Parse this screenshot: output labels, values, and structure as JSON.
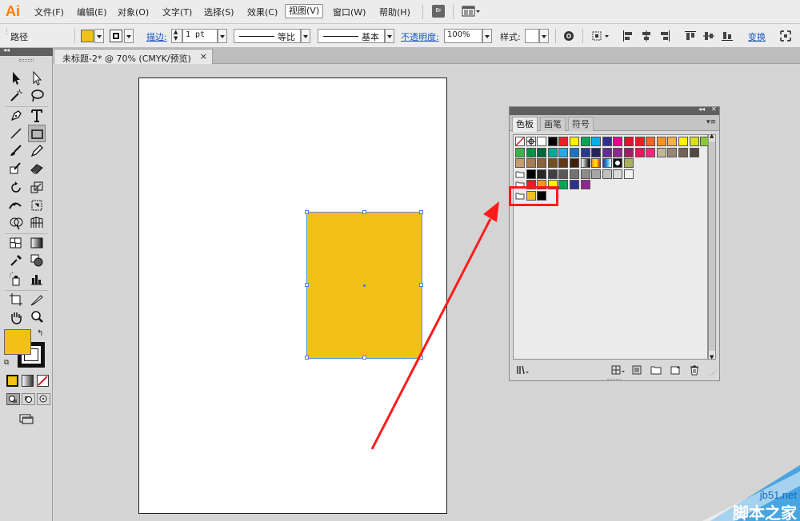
{
  "app": {
    "logo": "Ai"
  },
  "menu": {
    "file": "文件(F)",
    "edit": "编辑(E)",
    "object": "对象(O)",
    "type": "文字(T)",
    "select": "选择(S)",
    "effect": "效果(C)",
    "view": "视图(V)",
    "window": "窗口(W)",
    "help": "帮助(H)",
    "bridge": "Br"
  },
  "control": {
    "selection_type": "路径",
    "stroke_label": "描边:",
    "stroke_weight": "1 pt",
    "profile": "等比",
    "brush": "基本",
    "opacity_label": "不透明度:",
    "opacity": "100%",
    "style_label": "样式:",
    "transform": "变换"
  },
  "document": {
    "tab_title": "未标题-2* @ 70% (CMYK/预览)",
    "close": "×"
  },
  "swatches_panel": {
    "tabs": [
      "色板",
      "画笔",
      "符号"
    ],
    "rows": [
      [
        "none",
        "registration",
        "#ffffff",
        "#000000",
        "#ee1c25",
        "#fff200",
        "#00a651",
        "#00aeef",
        "#2e3192",
        "#ec008c",
        "#d7182a",
        "#ed1c24",
        "#f26522",
        "#f7941d",
        "#fbb040",
        "#fff200",
        "#d7df23",
        "#8dc63f"
      ],
      [
        "#39b54a",
        "#009444",
        "#006838",
        "#00a79d",
        "#27aae1",
        "#1c75bc",
        "#2b388f",
        "#262262",
        "#662d91",
        "#92278f",
        "#9e1f63",
        "#da1c5c",
        "#ee2a7b",
        "#c2b59b",
        "#998675",
        "#736357",
        "#534741"
      ],
      [
        "#c69c6d",
        "#a67c52",
        "#8c6239",
        "#754c24",
        "#603813",
        "#42210b",
        "gradient",
        "gradient2",
        "gradient3",
        "pattern1",
        "pattern2"
      ],
      [
        "folder",
        "#000000",
        "#262626",
        "#404040",
        "#595959",
        "#737373",
        "#8c8c8c",
        "#a6a6a6",
        "#bfbfbf",
        "#d9d9d9",
        "#f2f2f2"
      ],
      [
        "folder",
        "#ed1c24",
        "#f7941d",
        "#fff200",
        "#00a651",
        "#2e3192",
        "#92278f"
      ],
      [
        "folder",
        "#f2c117",
        "#000000"
      ]
    ]
  },
  "colors": {
    "accent_yellow": "#f2c117",
    "highlight_red": "#ff1b1b",
    "selection_blue": "#4a82d6"
  },
  "watermark": {
    "url": "jb51.net",
    "name": "脚本之家"
  }
}
